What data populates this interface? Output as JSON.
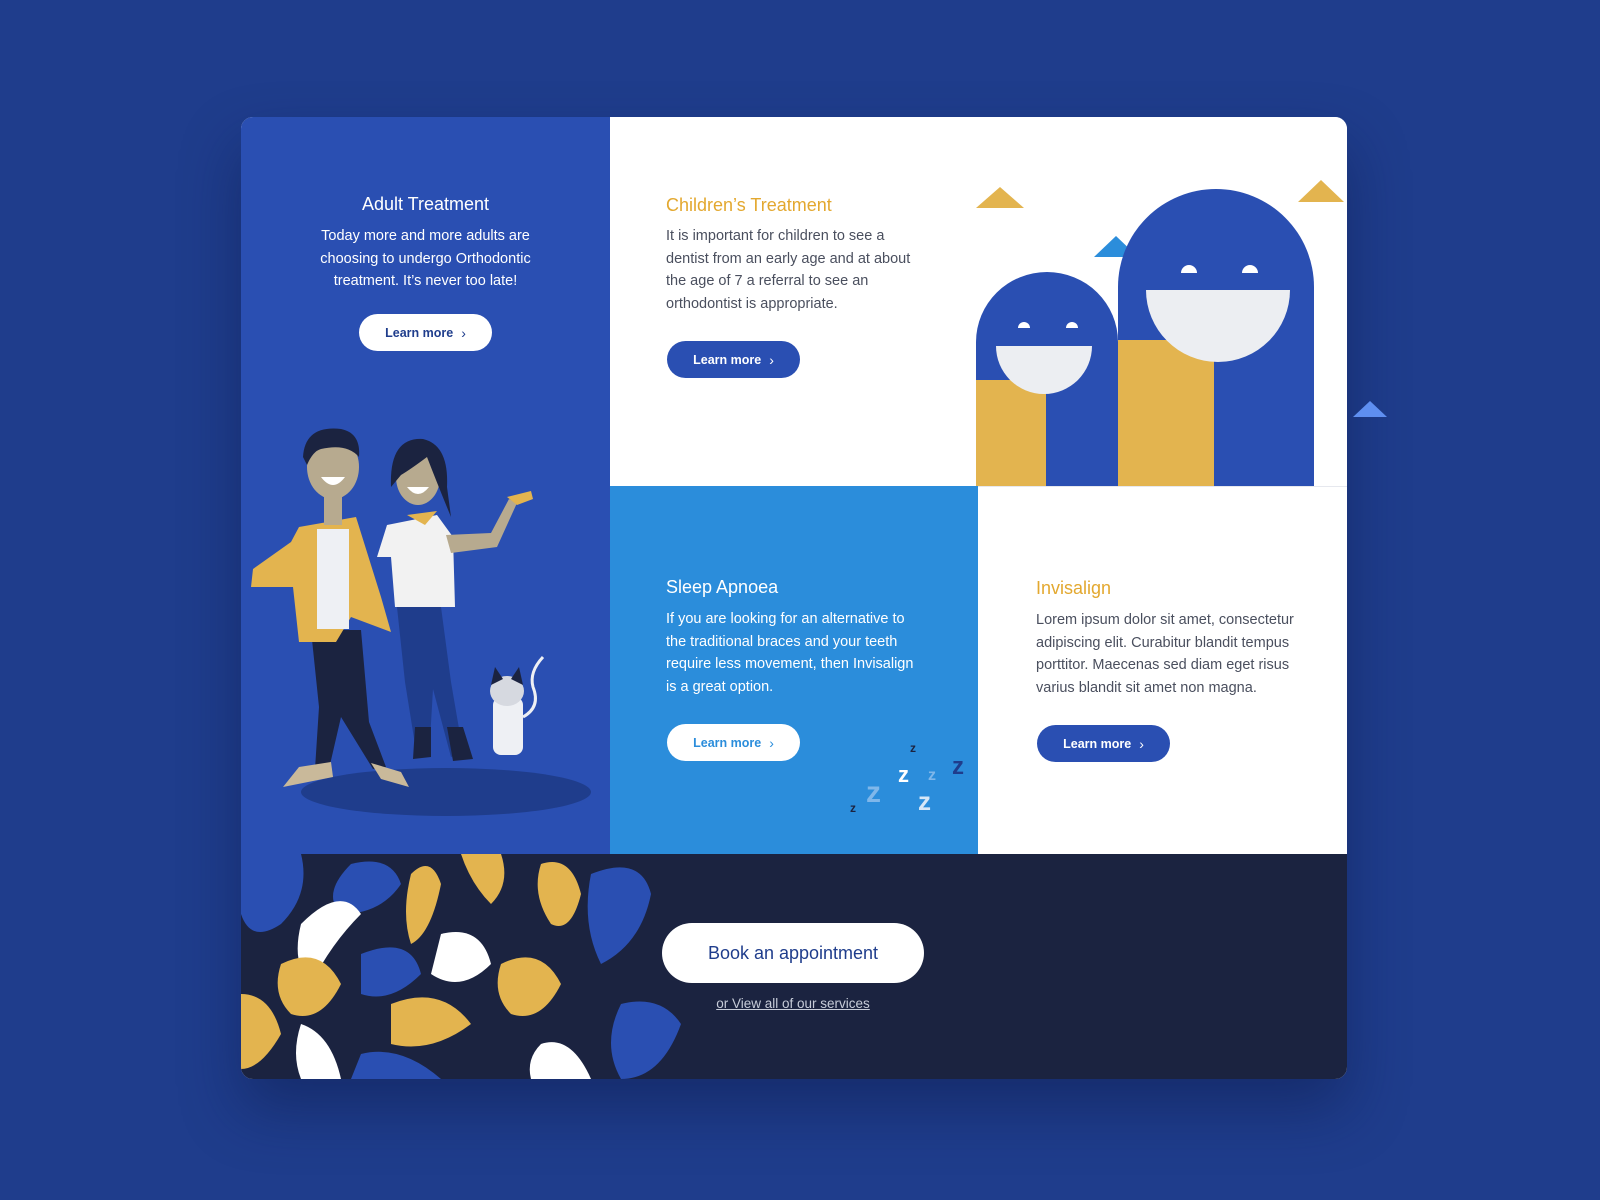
{
  "colors": {
    "page_bg": "#1f3d8c",
    "royal_blue": "#2a4fb2",
    "sky_blue": "#2b8ddb",
    "mustard": "#e3b44f",
    "navy": "#1b2340",
    "white": "#ffffff"
  },
  "adult": {
    "title": "Adult Treatment",
    "text": "Today more and more adults are choosing to undergo Orthodontic treatment. It’s never too late!",
    "button": "Learn more"
  },
  "children": {
    "title": "Children’s Treatment",
    "text": "It is important for children to see a dentist from an early age and at about the age of 7 a referral to see an orthodontist is appropriate.",
    "button": "Learn more"
  },
  "sleep": {
    "title": "Sleep Apnoea",
    "text": "If you are looking for an alternative to the traditional braces and your teeth require less movement, then Invisalign is a great option.",
    "button": "Learn more"
  },
  "invisalign": {
    "title": "Invisalign",
    "text": "Lorem ipsum dolor sit amet, consectetur adipiscing elit. Curabitur blandit tempus porttitor. Maecenas sed diam eget risus varius blandit sit amet non magna.",
    "button": "Learn more"
  },
  "footer": {
    "book_button": "Book an appointment",
    "view_all_link": "or View all of our services"
  },
  "icons": {
    "button_chevron": "chevron-right-icon",
    "adult_art": "couple-with-cat-illustration",
    "children_art": "smiling-faces-illustration",
    "sleep_art": "sleep-zzz-illustration",
    "footer_art": "abstract-petals-illustration"
  }
}
